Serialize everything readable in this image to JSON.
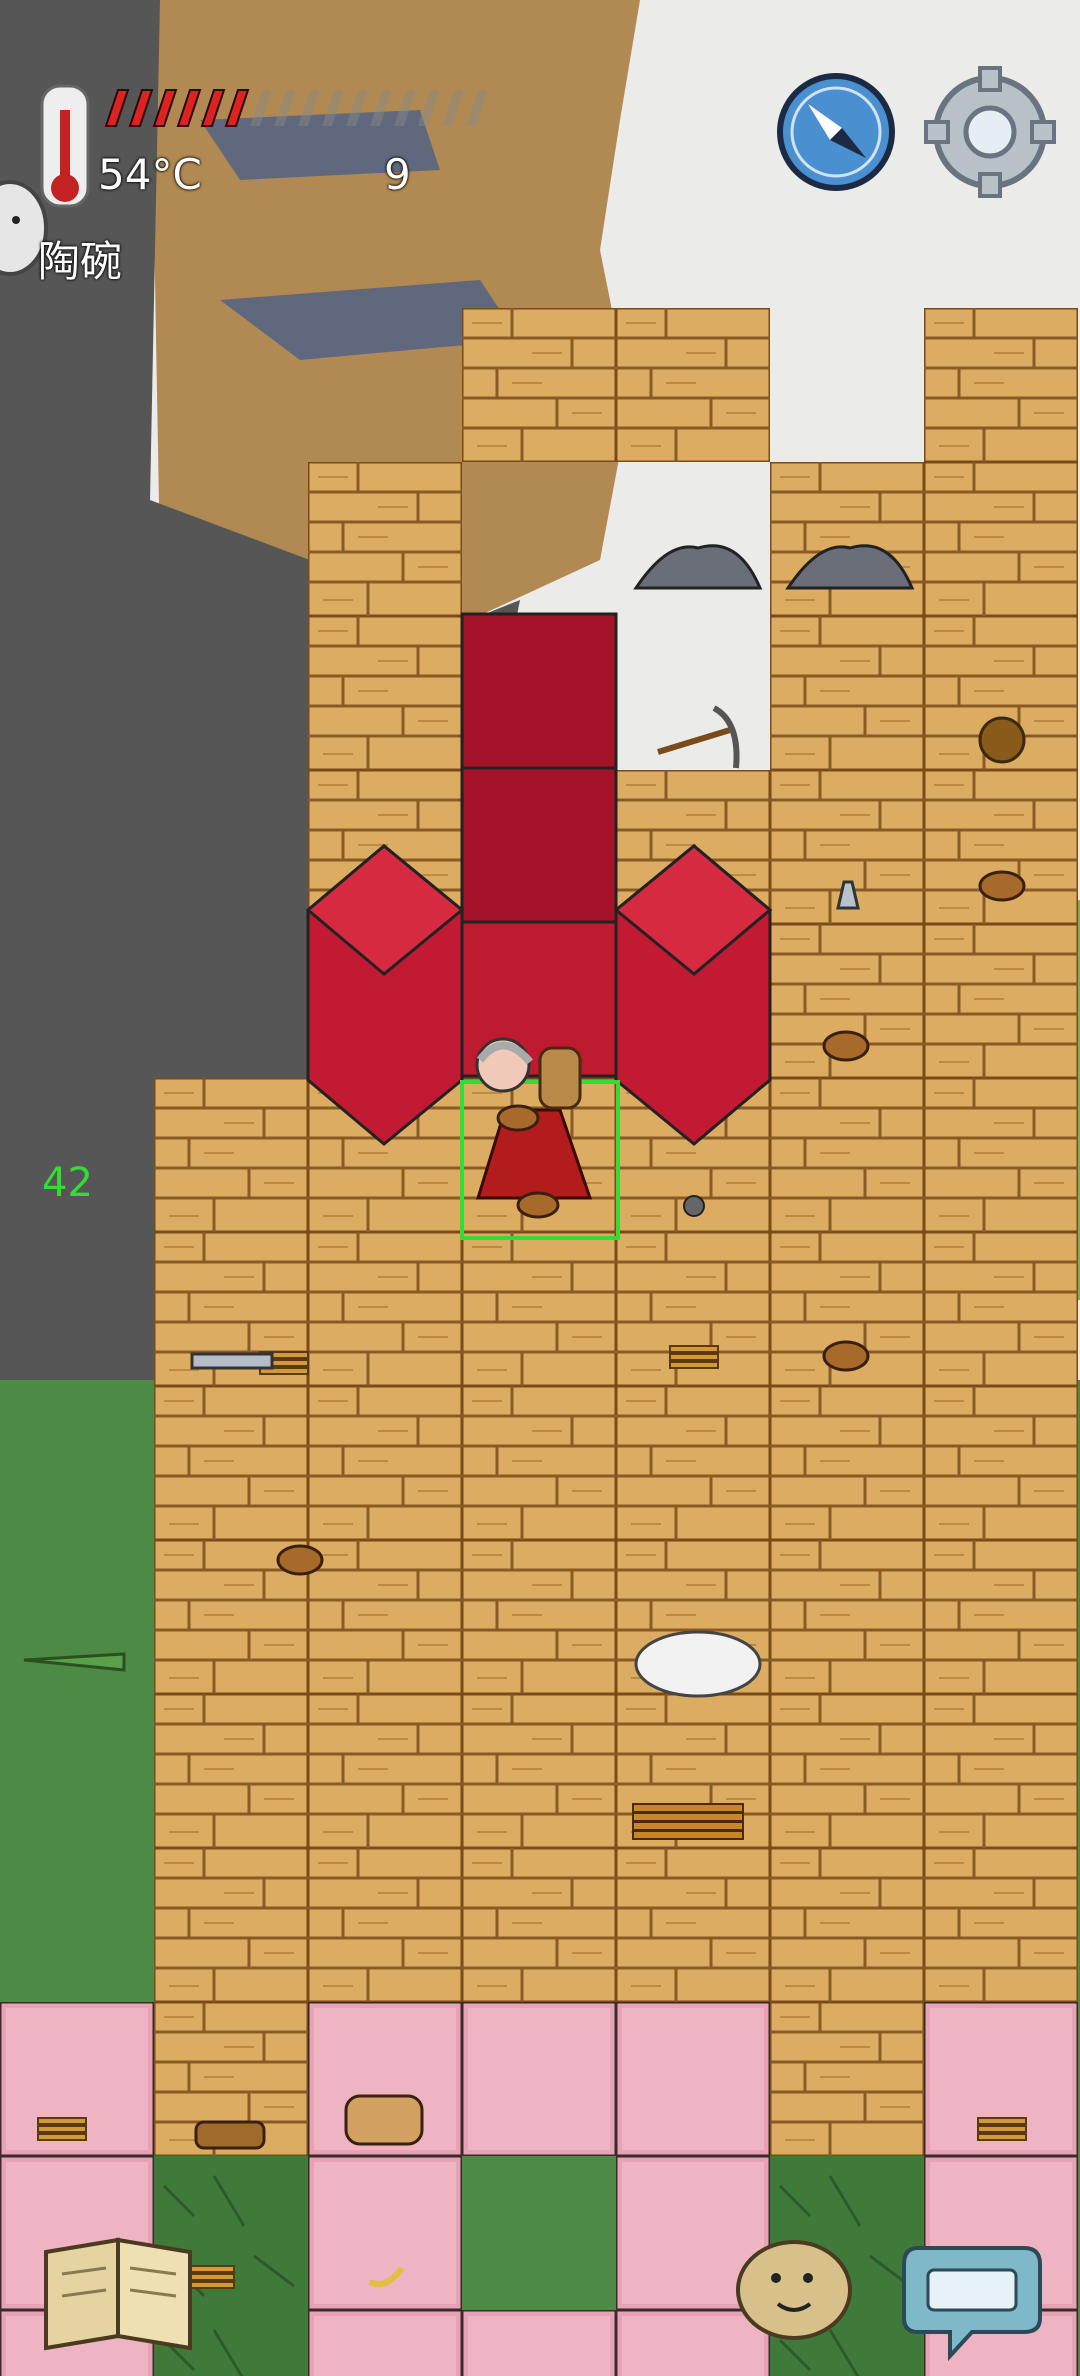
{
  "hud": {
    "temperature": "54°C",
    "food_count": "9",
    "held_item": "陶碗",
    "age": "42",
    "hunger_pips_filled": 6,
    "hunger_pips_total": 16
  },
  "colors": {
    "grass": "#6fa65a",
    "dark_ground": "#4e4e4e",
    "snow": "#ececec",
    "wood_floor": "#d9a85e",
    "pink_carpet": "#e8a6b8",
    "red_wall": "#b3142b",
    "selection": "#33dd33",
    "hunger": "#dd2222"
  },
  "icons": [
    "thermometer-icon",
    "compass-icon",
    "gear-icon",
    "journal-book-icon",
    "emote-face-icon",
    "keyboard-chat-icon"
  ],
  "tiles": {
    "wood": [
      "1-7",
      "1-8",
      "1-9",
      "1-10",
      "1-11",
      "1-12",
      "1-13",
      "2-3",
      "2-4",
      "2-5",
      "2-6",
      "2-7",
      "2-8",
      "2-9",
      "2-10",
      "2-11",
      "2-12",
      "2-13",
      "3-2",
      "3-5",
      "3-6",
      "3-7",
      "3-8",
      "3-9",
      "3-10",
      "3-11",
      "3-12",
      "3-13",
      "4-2",
      "4-5",
      "4-6",
      "4-7",
      "4-8",
      "4-9",
      "4-10",
      "4-11",
      "4-12",
      "4-13",
      "5-3",
      "5-4",
      "5-5",
      "5-6",
      "5-7",
      "5-8",
      "5-9",
      "5-10",
      "5-11",
      "5-12",
      "5-13",
      "6-2",
      "6-3",
      "6-4",
      "6-5",
      "6-6",
      "6-7",
      "6-8",
      "6-9",
      "6-10",
      "6-11",
      "6-12",
      "6-13"
    ],
    "pink": [
      "0-13",
      "0-14",
      "0-15",
      "2-13",
      "2-14",
      "2-15",
      "3-13",
      "3-15",
      "4-13",
      "4-14",
      "4-15",
      "6-13",
      "6-14",
      "6-15"
    ],
    "grass_dark": [
      "1-13",
      "1-14",
      "1-15",
      "5-14",
      "5-15"
    ]
  },
  "objects": [
    {
      "kind": "stone-pile",
      "name": "stone-pile"
    },
    {
      "kind": "stone-pile",
      "name": "stone-pile"
    },
    {
      "kind": "pickaxe",
      "name": "pickaxe"
    },
    {
      "kind": "burdock",
      "name": "burdock-burr"
    },
    {
      "kind": "bowl",
      "name": "clay-bowl"
    },
    {
      "kind": "bowl",
      "name": "clay-bowl"
    },
    {
      "kind": "bowl",
      "name": "clay-bowl"
    },
    {
      "kind": "bowl",
      "name": "clay-bowl"
    },
    {
      "kind": "flask",
      "name": "glass-flask"
    },
    {
      "kind": "stone",
      "name": "round-stone"
    },
    {
      "kind": "kindling",
      "name": "kindling"
    },
    {
      "kind": "kindling",
      "name": "kindling"
    },
    {
      "kind": "kindling",
      "name": "kindling"
    },
    {
      "kind": "kindling",
      "name": "kindling"
    },
    {
      "kind": "kindling",
      "name": "kindling"
    },
    {
      "kind": "kindling",
      "name": "kindling"
    },
    {
      "kind": "steel",
      "name": "steel-ingots"
    },
    {
      "kind": "carrots",
      "name": "carrot-bunch"
    },
    {
      "kind": "wool",
      "name": "wool-fleece"
    },
    {
      "kind": "firewood",
      "name": "firewood-pile"
    },
    {
      "kind": "log",
      "name": "log"
    },
    {
      "kind": "steamer",
      "name": "bamboo-steamer"
    },
    {
      "kind": "banana",
      "name": "banana-peel"
    }
  ]
}
